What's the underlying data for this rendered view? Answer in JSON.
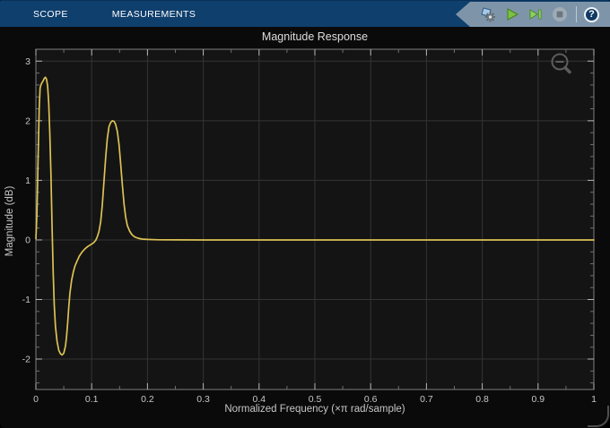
{
  "toolbar": {
    "background": "#0F3F6D",
    "cluster_background": "#7E95A9",
    "tabs": [
      {
        "label": "SCOPE",
        "active": true
      },
      {
        "label": "MEASUREMENTS",
        "active": false
      }
    ],
    "help_label": "?"
  },
  "colors": {
    "line": "#DCC254",
    "axes_background": "#141414",
    "grid": "#343434",
    "tick_label": "#C6C6C6"
  },
  "chart_data": {
    "type": "line",
    "title": "Magnitude Response",
    "xlabel": "Normalized Frequency (×π rad/sample)",
    "ylabel": "Magnitude (dB)",
    "xlim": [
      0,
      1
    ],
    "ylim": [
      -2.51,
      3.2
    ],
    "grid": true,
    "legend": false,
    "x_major_ticks": [
      0,
      0.1,
      0.2,
      0.3,
      0.4,
      0.5,
      0.6,
      0.7,
      0.8,
      0.9,
      1
    ],
    "x_tick_labels": [
      "0",
      "0.1",
      "0.2",
      "0.3",
      "0.4",
      "0.5",
      "0.6",
      "0.7",
      "0.8",
      "0.9",
      "1"
    ],
    "x_minor_step": 0.05,
    "y_major_ticks": [
      -2,
      -1,
      0,
      1,
      2,
      3
    ],
    "y_tick_labels": [
      "-2",
      "-1",
      "0",
      "1",
      "2",
      "3"
    ],
    "y_minor_step": 0.2,
    "line_color": "#DCC254",
    "series": [
      {
        "name": "Magnitude Response",
        "points": [
          [
            0,
            0.02
          ],
          [
            0.002,
            0.45
          ],
          [
            0.004,
            1.4
          ],
          [
            0.006,
            2.2
          ],
          [
            0.0075,
            2.55
          ],
          [
            0.009,
            2.6
          ],
          [
            0.011,
            2.64
          ],
          [
            0.013,
            2.67
          ],
          [
            0.015,
            2.71
          ],
          [
            0.017,
            2.73
          ],
          [
            0.019,
            2.7
          ],
          [
            0.021,
            2.58
          ],
          [
            0.023,
            2.3
          ],
          [
            0.025,
            1.8
          ],
          [
            0.027,
            1.1
          ],
          [
            0.029,
            0.25
          ],
          [
            0.031,
            -0.55
          ],
          [
            0.033,
            -1.1
          ],
          [
            0.035,
            -1.45
          ],
          [
            0.038,
            -1.7
          ],
          [
            0.041,
            -1.85
          ],
          [
            0.044,
            -1.91
          ],
          [
            0.047,
            -1.93
          ],
          [
            0.05,
            -1.9
          ],
          [
            0.053,
            -1.78
          ],
          [
            0.055,
            -1.62
          ],
          [
            0.057,
            -1.38
          ],
          [
            0.059,
            -1.12
          ],
          [
            0.061,
            -0.9
          ],
          [
            0.064,
            -0.68
          ],
          [
            0.067,
            -0.54
          ],
          [
            0.07,
            -0.44
          ],
          [
            0.074,
            -0.35
          ],
          [
            0.078,
            -0.27
          ],
          [
            0.083,
            -0.2
          ],
          [
            0.088,
            -0.15
          ],
          [
            0.093,
            -0.11
          ],
          [
            0.098,
            -0.08
          ],
          [
            0.103,
            -0.05
          ],
          [
            0.107,
            -0.01
          ],
          [
            0.11,
            0.05
          ],
          [
            0.113,
            0.14
          ],
          [
            0.116,
            0.3
          ],
          [
            0.119,
            0.58
          ],
          [
            0.122,
            0.98
          ],
          [
            0.125,
            1.38
          ],
          [
            0.128,
            1.7
          ],
          [
            0.131,
            1.9
          ],
          [
            0.134,
            1.97
          ],
          [
            0.137,
            2.0
          ],
          [
            0.14,
            1.99
          ],
          [
            0.143,
            1.94
          ],
          [
            0.146,
            1.82
          ],
          [
            0.149,
            1.6
          ],
          [
            0.152,
            1.28
          ],
          [
            0.155,
            0.92
          ],
          [
            0.158,
            0.6
          ],
          [
            0.161,
            0.38
          ],
          [
            0.164,
            0.24
          ],
          [
            0.168,
            0.15
          ],
          [
            0.172,
            0.09
          ],
          [
            0.177,
            0.05
          ],
          [
            0.183,
            0.03
          ],
          [
            0.19,
            0.015
          ],
          [
            0.2,
            0.008
          ],
          [
            0.22,
            0.003
          ],
          [
            0.25,
            0.001
          ],
          [
            0.3,
            0
          ],
          [
            0.4,
            0
          ],
          [
            0.5,
            0
          ],
          [
            0.6,
            0
          ],
          [
            0.7,
            0
          ],
          [
            0.8,
            0
          ],
          [
            0.9,
            0
          ],
          [
            1,
            0
          ]
        ]
      }
    ]
  }
}
